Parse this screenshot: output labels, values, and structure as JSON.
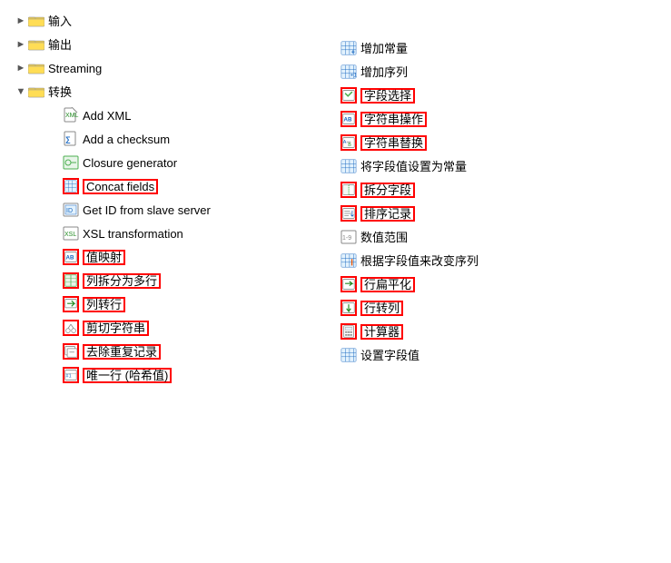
{
  "tree": {
    "topLevel": [
      {
        "id": "input",
        "label": "输入",
        "expanded": false,
        "level": 0
      },
      {
        "id": "output",
        "label": "输出",
        "expanded": false,
        "level": 0
      },
      {
        "id": "streaming",
        "label": "Streaming",
        "expanded": false,
        "level": 0
      },
      {
        "id": "transform",
        "label": "转换",
        "expanded": true,
        "level": 0
      }
    ],
    "transformChildren": [
      {
        "id": "add-xml",
        "label": "Add XML",
        "highlighted": false
      },
      {
        "id": "add-checksum",
        "label": "Add a checksum",
        "highlighted": false
      },
      {
        "id": "closure-generator",
        "label": "Closure generator",
        "highlighted": false
      },
      {
        "id": "concat-fields",
        "label": "Concat fields",
        "highlighted": true
      },
      {
        "id": "get-id",
        "label": "Get ID from slave server",
        "highlighted": false
      },
      {
        "id": "xsl-transform",
        "label": "XSL transformation",
        "highlighted": false
      },
      {
        "id": "value-map",
        "label": "值映射",
        "highlighted": true
      },
      {
        "id": "split-col-rows",
        "label": "列拆分为多行",
        "highlighted": true
      },
      {
        "id": "col-to-row",
        "label": "列转行",
        "highlighted": true
      },
      {
        "id": "cut-string",
        "label": "剪切字符串",
        "highlighted": true
      },
      {
        "id": "remove-dup",
        "label": "去除重复记录",
        "highlighted": true
      },
      {
        "id": "unique-row",
        "label": "唯一行 (哈希值)",
        "highlighted": true
      }
    ]
  },
  "rightPanel": [
    {
      "id": "add-constant",
      "label": "增加常量",
      "highlighted": false
    },
    {
      "id": "add-sequence",
      "label": "增加序列",
      "highlighted": false
    },
    {
      "id": "field-select",
      "label": "字段选择",
      "highlighted": true
    },
    {
      "id": "string-ops",
      "label": "字符串操作",
      "highlighted": true
    },
    {
      "id": "string-replace",
      "label": "字符串替换",
      "highlighted": true
    },
    {
      "id": "set-field-const",
      "label": "将字段值设置为常量",
      "highlighted": false
    },
    {
      "id": "split-field",
      "label": "拆分字段",
      "highlighted": true
    },
    {
      "id": "sort-records",
      "label": "排序记录",
      "highlighted": true
    },
    {
      "id": "numeric-range",
      "label": "数值范围",
      "highlighted": false
    },
    {
      "id": "change-seq",
      "label": "根据字段值来改变序列",
      "highlighted": false
    },
    {
      "id": "row-flatten",
      "label": "行扁平化",
      "highlighted": true
    },
    {
      "id": "row-to-col",
      "label": "行转列",
      "highlighted": true
    },
    {
      "id": "calculator",
      "label": "计算器",
      "highlighted": true
    },
    {
      "id": "set-field-val",
      "label": "设置字段值",
      "highlighted": false
    }
  ]
}
